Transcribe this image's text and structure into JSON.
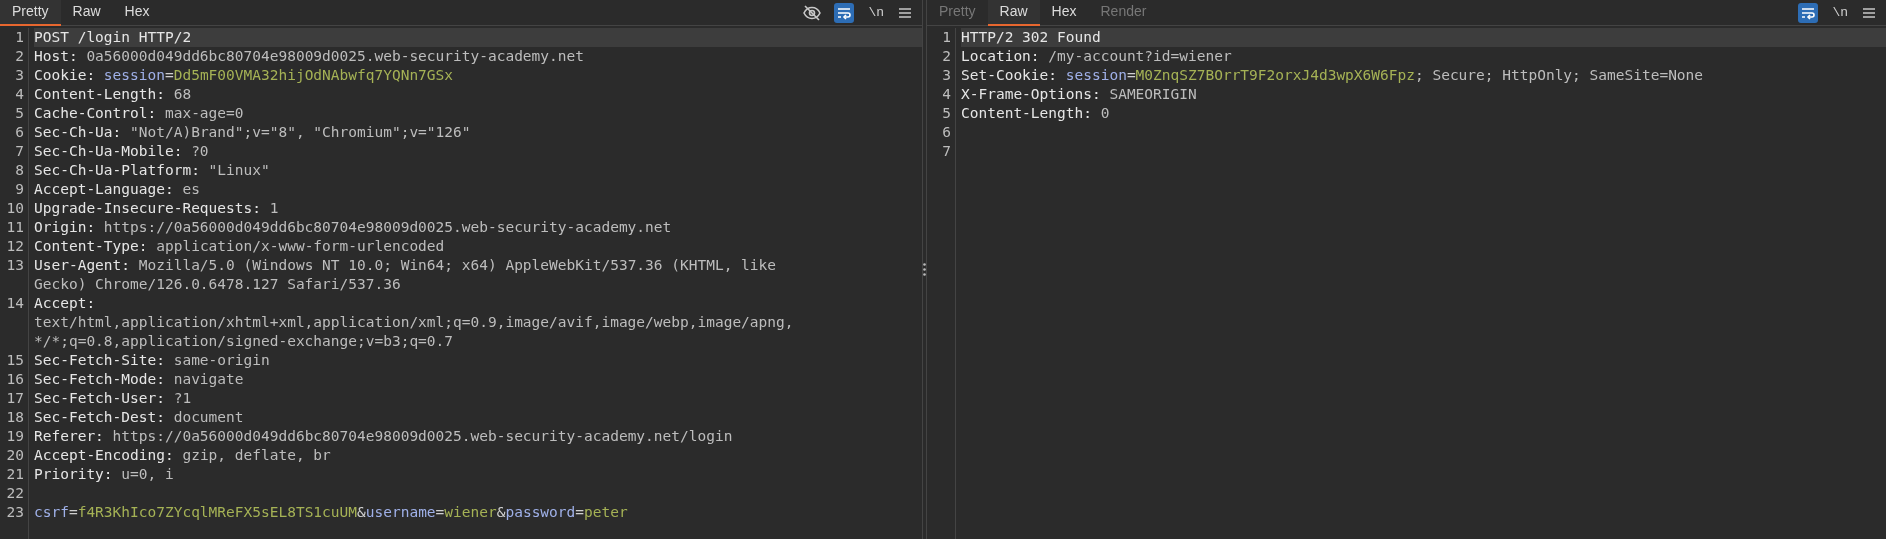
{
  "request": {
    "tabs": [
      {
        "label": "Pretty",
        "selected": true,
        "disabled": false
      },
      {
        "label": "Raw",
        "selected": false,
        "disabled": false
      },
      {
        "label": "Hex",
        "selected": false,
        "disabled": false
      }
    ],
    "toolbar": [
      {
        "kind": "hide-icon",
        "active": false
      },
      {
        "kind": "wrap-icon",
        "active": true
      },
      {
        "kind": "text",
        "text": "\\n",
        "active": false
      },
      {
        "kind": "menu-icon",
        "active": false
      }
    ],
    "lines": [
      {
        "number": "1",
        "current": true,
        "rows": [
          [
            {
              "kind": "plain",
              "text": "POST /login HTTP/2"
            }
          ]
        ]
      },
      {
        "number": "2",
        "current": false,
        "rows": [
          [
            {
              "kind": "name",
              "text": "Host:"
            },
            {
              "kind": "value",
              "text": " 0a56000d049dd6bc80704e98009d0025.web-security-academy.net"
            }
          ]
        ]
      },
      {
        "number": "3",
        "current": false,
        "rows": [
          [
            {
              "kind": "name",
              "text": "Cookie:"
            },
            {
              "kind": "param_name",
              "text": " session"
            },
            {
              "kind": "sep",
              "text": "="
            },
            {
              "kind": "param_value",
              "text": "Dd5mF00VMA32hijOdNAbwfq7YQNn7GSx"
            }
          ]
        ]
      },
      {
        "number": "4",
        "current": false,
        "rows": [
          [
            {
              "kind": "name",
              "text": "Content-Length:"
            },
            {
              "kind": "value",
              "text": " 68"
            }
          ]
        ]
      },
      {
        "number": "5",
        "current": false,
        "rows": [
          [
            {
              "kind": "name",
              "text": "Cache-Control:"
            },
            {
              "kind": "value",
              "text": " max-age=0"
            }
          ]
        ]
      },
      {
        "number": "6",
        "current": false,
        "rows": [
          [
            {
              "kind": "name",
              "text": "Sec-Ch-Ua:"
            },
            {
              "kind": "value",
              "text": " \"Not/A)Brand\";v=\"8\", \"Chromium\";v=\"126\""
            }
          ]
        ]
      },
      {
        "number": "7",
        "current": false,
        "rows": [
          [
            {
              "kind": "name",
              "text": "Sec-Ch-Ua-Mobile:"
            },
            {
              "kind": "value",
              "text": " ?0"
            }
          ]
        ]
      },
      {
        "number": "8",
        "current": false,
        "rows": [
          [
            {
              "kind": "name",
              "text": "Sec-Ch-Ua-Platform:"
            },
            {
              "kind": "value",
              "text": " \"Linux\""
            }
          ]
        ]
      },
      {
        "number": "9",
        "current": false,
        "rows": [
          [
            {
              "kind": "name",
              "text": "Accept-Language:"
            },
            {
              "kind": "value",
              "text": " es"
            }
          ]
        ]
      },
      {
        "number": "10",
        "current": false,
        "rows": [
          [
            {
              "kind": "name",
              "text": "Upgrade-Insecure-Requests:"
            },
            {
              "kind": "value",
              "text": " 1"
            }
          ]
        ]
      },
      {
        "number": "11",
        "current": false,
        "rows": [
          [
            {
              "kind": "name",
              "text": "Origin:"
            },
            {
              "kind": "value",
              "text": " https://0a56000d049dd6bc80704e98009d0025.web-security-academy.net"
            }
          ]
        ]
      },
      {
        "number": "12",
        "current": false,
        "rows": [
          [
            {
              "kind": "name",
              "text": "Content-Type:"
            },
            {
              "kind": "value",
              "text": " application/x-www-form-urlencoded"
            }
          ]
        ]
      },
      {
        "number": "13",
        "current": false,
        "rows": [
          [
            {
              "kind": "name",
              "text": "User-Agent:"
            },
            {
              "kind": "value",
              "text": " Mozilla/5.0 (Windows NT 10.0; Win64; x64) AppleWebKit/537.36 (KHTML, like"
            }
          ],
          [
            {
              "kind": "value",
              "text": "Gecko) Chrome/126.0.6478.127 Safari/537.36"
            }
          ]
        ]
      },
      {
        "number": "14",
        "current": false,
        "rows": [
          [
            {
              "kind": "name",
              "text": "Accept:"
            }
          ],
          [
            {
              "kind": "value",
              "text": "text/html,application/xhtml+xml,application/xml;q=0.9,image/avif,image/webp,image/apng,"
            }
          ],
          [
            {
              "kind": "value",
              "text": "*/*;q=0.8,application/signed-exchange;v=b3;q=0.7"
            }
          ]
        ]
      },
      {
        "number": "15",
        "current": false,
        "rows": [
          [
            {
              "kind": "name",
              "text": "Sec-Fetch-Site:"
            },
            {
              "kind": "value",
              "text": " same-origin"
            }
          ]
        ]
      },
      {
        "number": "16",
        "current": false,
        "rows": [
          [
            {
              "kind": "name",
              "text": "Sec-Fetch-Mode:"
            },
            {
              "kind": "value",
              "text": " navigate"
            }
          ]
        ]
      },
      {
        "number": "17",
        "current": false,
        "rows": [
          [
            {
              "kind": "name",
              "text": "Sec-Fetch-User:"
            },
            {
              "kind": "value",
              "text": " ?1"
            }
          ]
        ]
      },
      {
        "number": "18",
        "current": false,
        "rows": [
          [
            {
              "kind": "name",
              "text": "Sec-Fetch-Dest:"
            },
            {
              "kind": "value",
              "text": " document"
            }
          ]
        ]
      },
      {
        "number": "19",
        "current": false,
        "rows": [
          [
            {
              "kind": "name",
              "text": "Referer:"
            },
            {
              "kind": "value",
              "text": " https://0a56000d049dd6bc80704e98009d0025.web-security-academy.net/login"
            }
          ]
        ]
      },
      {
        "number": "20",
        "current": false,
        "rows": [
          [
            {
              "kind": "name",
              "text": "Accept-Encoding:"
            },
            {
              "kind": "value",
              "text": " gzip, deflate, br"
            }
          ]
        ]
      },
      {
        "number": "21",
        "current": false,
        "rows": [
          [
            {
              "kind": "name",
              "text": "Priority:"
            },
            {
              "kind": "value",
              "text": " u=0, i"
            }
          ]
        ]
      },
      {
        "number": "22",
        "current": false,
        "rows": [
          []
        ]
      },
      {
        "number": "23",
        "current": false,
        "rows": [
          [
            {
              "kind": "param_name",
              "text": "csrf"
            },
            {
              "kind": "sep",
              "text": "="
            },
            {
              "kind": "param_value",
              "text": "f4R3KhIco7ZYcqlMReFX5sEL8TS1cuUM"
            },
            {
              "kind": "sep",
              "text": "&"
            },
            {
              "kind": "param_name",
              "text": "username"
            },
            {
              "kind": "sep",
              "text": "="
            },
            {
              "kind": "param_value",
              "text": "wiener"
            },
            {
              "kind": "sep",
              "text": "&"
            },
            {
              "kind": "param_name",
              "text": "password"
            },
            {
              "kind": "sep",
              "text": "="
            },
            {
              "kind": "param_value",
              "text": "peter"
            }
          ]
        ]
      }
    ]
  },
  "response": {
    "tabs": [
      {
        "label": "Pretty",
        "selected": false,
        "disabled": true
      },
      {
        "label": "Raw",
        "selected": true,
        "disabled": false
      },
      {
        "label": "Hex",
        "selected": false,
        "disabled": false
      },
      {
        "label": "Render",
        "selected": false,
        "disabled": true
      }
    ],
    "toolbar": [
      {
        "kind": "wrap-icon",
        "active": true
      },
      {
        "kind": "text",
        "text": "\\n",
        "active": false
      },
      {
        "kind": "menu-icon",
        "active": false
      }
    ],
    "lines": [
      {
        "number": "1",
        "current": true,
        "rows": [
          [
            {
              "kind": "plain",
              "text": "HTTP/2 302 Found"
            }
          ]
        ]
      },
      {
        "number": "2",
        "current": false,
        "rows": [
          [
            {
              "kind": "name",
              "text": "Location:"
            },
            {
              "kind": "value",
              "text": " /my-account?id=wiener"
            }
          ]
        ]
      },
      {
        "number": "3",
        "current": false,
        "rows": [
          [
            {
              "kind": "name",
              "text": "Set-Cookie:"
            },
            {
              "kind": "param_name",
              "text": " session"
            },
            {
              "kind": "sep",
              "text": "="
            },
            {
              "kind": "param_value",
              "text": "M0ZnqSZ7BOrrT9F2orxJ4d3wpX6W6Fpz"
            },
            {
              "kind": "value",
              "text": "; Secure; HttpOnly; SameSite=None"
            }
          ]
        ]
      },
      {
        "number": "4",
        "current": false,
        "rows": [
          [
            {
              "kind": "name",
              "text": "X-Frame-Options:"
            },
            {
              "kind": "value",
              "text": " SAMEORIGIN"
            }
          ]
        ]
      },
      {
        "number": "5",
        "current": false,
        "rows": [
          [
            {
              "kind": "name",
              "text": "Content-Length:"
            },
            {
              "kind": "value",
              "text": " 0"
            }
          ]
        ]
      },
      {
        "number": "6",
        "current": false,
        "rows": [
          []
        ]
      },
      {
        "number": "7",
        "current": false,
        "rows": [
          []
        ]
      }
    ]
  }
}
